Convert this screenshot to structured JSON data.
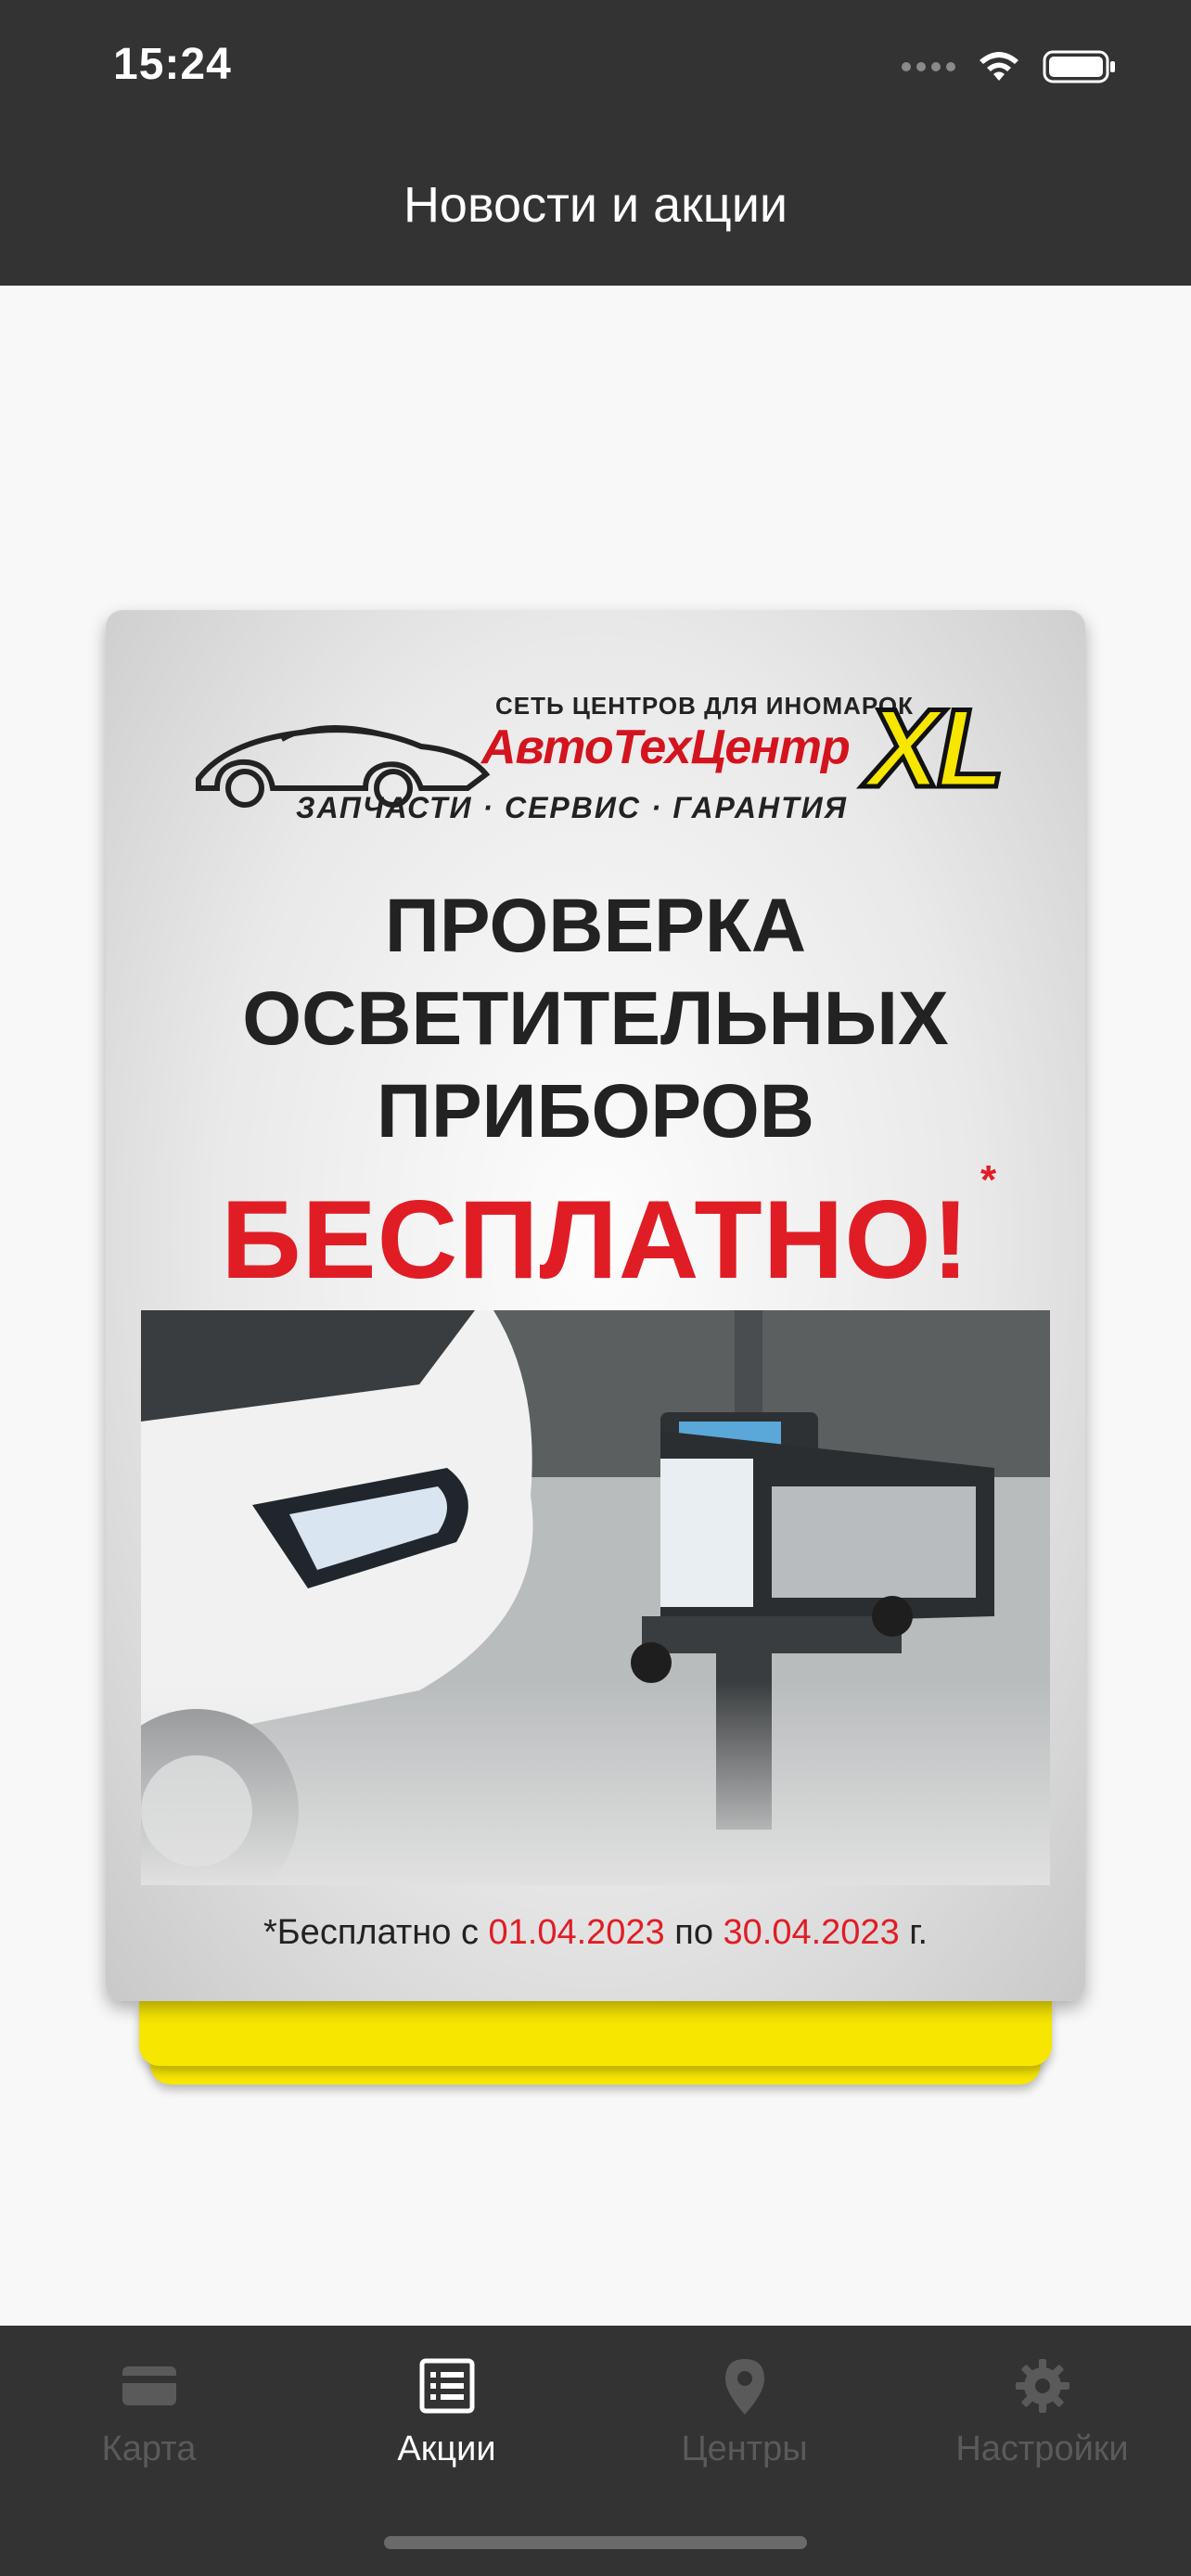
{
  "status_bar": {
    "time": "15:24"
  },
  "header": {
    "title": "Новости и акции"
  },
  "promo": {
    "logo_subtitle": "СЕТЬ ЦЕНТРОВ ДЛЯ ИНОМАРОК",
    "logo_brand": "АвтоТехЦентр",
    "logo_xl": "XL",
    "logo_tagline": "ЗАПЧАСТИ · СЕРВИС · ГАРАНТИЯ",
    "headline_line1": "ПРОВЕРКА",
    "headline_line2": "ОСВЕТИТЕЛЬНЫХ",
    "headline_line3": "ПРИБОРОВ",
    "free_text": "БЕСПЛАТНО!",
    "asterisk": "*",
    "footnote_prefix": "*Бесплатно с ",
    "footnote_from": "01.04.2023",
    "footnote_mid": " по ",
    "footnote_to": "30.04.2023",
    "footnote_suffix": " г."
  },
  "tabs": [
    {
      "label": "Карта",
      "icon": "card-icon",
      "active": false
    },
    {
      "label": "Акции",
      "icon": "list-icon",
      "active": true
    },
    {
      "label": "Центры",
      "icon": "location-pin-icon",
      "active": false
    },
    {
      "label": "Настройки",
      "icon": "gear-icon",
      "active": false
    }
  ],
  "colors": {
    "header_bg": "#333333",
    "tabbar_bg": "#333333",
    "accent_yellow": "#f7e600",
    "accent_red": "#e01d25",
    "tab_inactive": "#5a5a5a",
    "tab_active": "#ffffff"
  }
}
